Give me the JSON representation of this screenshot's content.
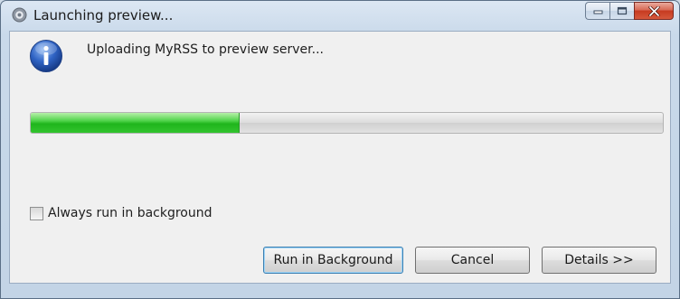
{
  "window": {
    "title": "Launching preview..."
  },
  "dialog": {
    "message": "Uploading MyRSS to preview server...",
    "progress_fraction": 0.33,
    "always_background_label": "Always run in background",
    "always_background_checked": false
  },
  "buttons": {
    "run_in_background": "Run in Background",
    "cancel": "Cancel",
    "details": "Details >>"
  },
  "icons": {
    "title": "eclipse-app-icon",
    "message": "info-icon"
  },
  "colors": {
    "progress_green": "#22b51f",
    "close_red": "#c63a20",
    "default_button_border": "#3c7fb1"
  }
}
